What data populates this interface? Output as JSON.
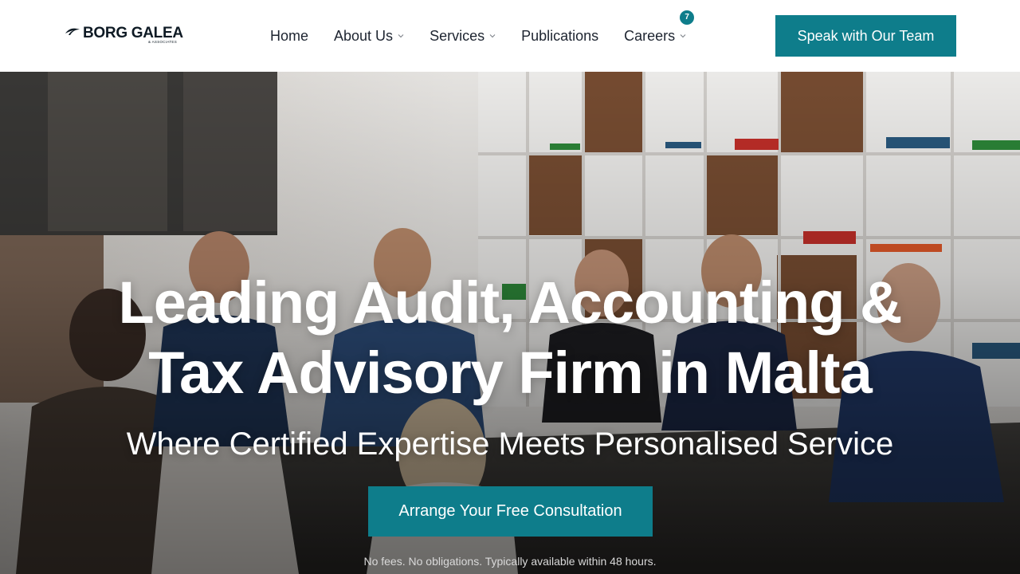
{
  "header": {
    "logo": {
      "name": "BORG GALEA",
      "sub": "& ASSOCIATES"
    },
    "nav": [
      {
        "label": "Home",
        "has_dropdown": false
      },
      {
        "label": "About Us",
        "has_dropdown": true
      },
      {
        "label": "Services",
        "has_dropdown": true
      },
      {
        "label": "Publications",
        "has_dropdown": false
      },
      {
        "label": "Careers",
        "has_dropdown": true,
        "badge": "7"
      }
    ],
    "cta_label": "Speak with Our Team"
  },
  "hero": {
    "title_line1": "Leading Audit, Accounting &",
    "title_line2": "Tax Advisory Firm in Malta",
    "subtitle": "Where Certified Expertise Meets Personalised Service",
    "cta_label": "Arrange Your Free Consultation",
    "note": "No fees. No obligations. Typically available within 48 hours."
  },
  "colors": {
    "accent": "#0e7d8b",
    "text_dark": "#1d2430",
    "white": "#ffffff"
  },
  "icons": {
    "logo_mark": "wave-logo-icon",
    "dropdown": "chevron-down-icon"
  }
}
